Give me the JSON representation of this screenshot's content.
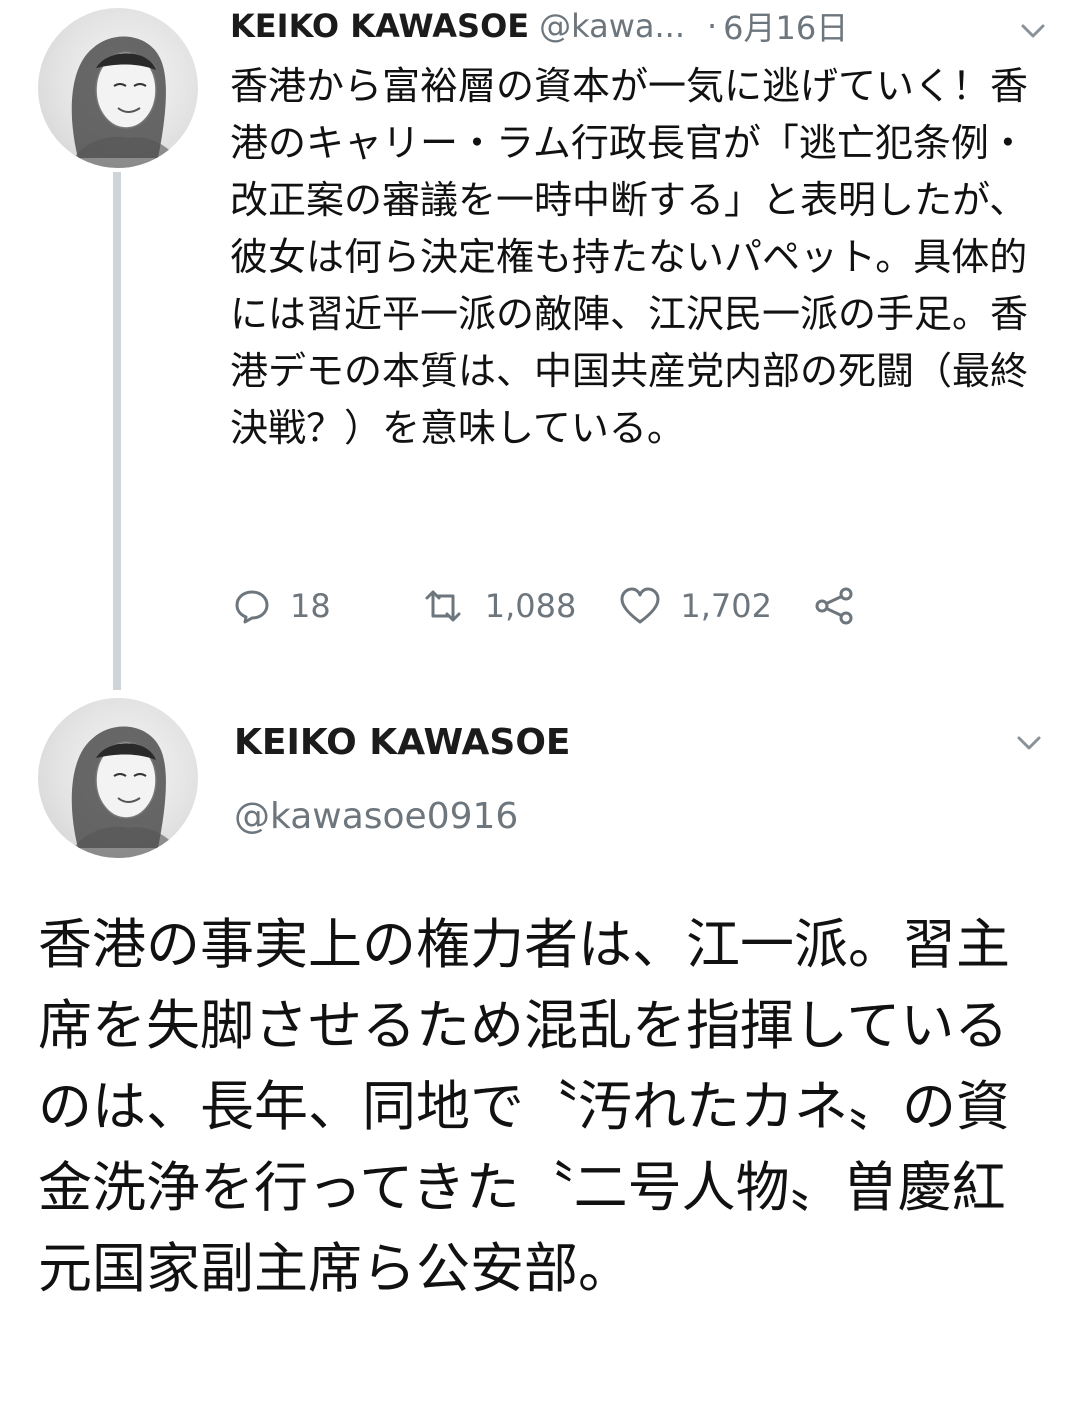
{
  "tweet1": {
    "author_name": "KEIKO KAWASOE",
    "author_handle": "@kawa...",
    "separator": "·",
    "date": "6月16日",
    "text": "香港から富裕層の資本が一気に逃げていく！香港のキャリー・ラム行政長官が「逃亡犯条例・改正案の審議を一時中断する」と表明したが、彼女は何ら決定権も持たないパペット。具体的には習近平一派の敵陣、江沢民一派の手足。香港デモの本質は、中国共産党内部の死闘（最終決戦？）を意味している。",
    "reply_count": "18",
    "retweet_count": "1,088",
    "like_count": "1,702"
  },
  "tweet2": {
    "author_name": "KEIKO KAWASOE",
    "author_handle": "@kawasoe0916",
    "text": "香港の事実上の権力者は、江一派。習主席を失脚させるため混乱を指揮しているのは、長年、同地で〝汚れたカネ〟の資金洗浄を行ってきた〝二号人物〟曽慶紅元国家副主席ら公安部。"
  },
  "icons": {
    "reply": "reply-icon",
    "retweet": "retweet-icon",
    "like": "like-icon",
    "share": "share-icon",
    "caret": "chevron-down-icon",
    "avatar": "avatar"
  },
  "colors": {
    "text": "#111111",
    "secondary": "#6e767d",
    "thread_line": "#cfd4d9",
    "background": "#ffffff"
  }
}
